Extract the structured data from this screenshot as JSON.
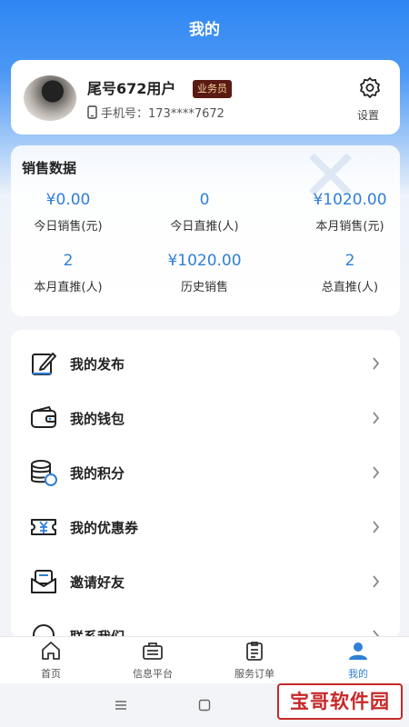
{
  "header": {
    "title": "我的"
  },
  "profile": {
    "name": "尾号672用户",
    "role_badge": "业务员",
    "phone_label": "手机号：173****7672",
    "settings_label": "设置"
  },
  "sales": {
    "title": "销售数据",
    "stats": [
      {
        "value": "¥0.00",
        "label": "今日销售(元)"
      },
      {
        "value": "0",
        "label": "今日直推(人)"
      },
      {
        "value": "¥1020.00",
        "label": "本月销售(元)"
      },
      {
        "value": "2",
        "label": "本月直推(人)"
      },
      {
        "value": "¥1020.00",
        "label": "历史销售"
      },
      {
        "value": "2",
        "label": "总直推(人)"
      }
    ]
  },
  "menu": {
    "items": [
      {
        "label": "我的发布",
        "icon": "edit-icon"
      },
      {
        "label": "我的钱包",
        "icon": "wallet-icon"
      },
      {
        "label": "我的积分",
        "icon": "coins-icon"
      },
      {
        "label": "我的优惠券",
        "icon": "coupon-icon"
      },
      {
        "label": "邀请好友",
        "icon": "invite-icon"
      },
      {
        "label": "联系我们",
        "icon": "headset-icon"
      }
    ]
  },
  "tabs": [
    {
      "label": "首页",
      "icon": "home-icon"
    },
    {
      "label": "信息平台",
      "icon": "briefcase-icon"
    },
    {
      "label": "服务订单",
      "icon": "clipboard-icon"
    },
    {
      "label": "我的",
      "icon": "user-icon",
      "active": true
    }
  ],
  "watermark": "宝哥软件园",
  "colors": {
    "accent": "#2f7fd6",
    "header": "#2f86f3",
    "badge_bg": "#5a1a14",
    "badge_text": "#f3d29a"
  }
}
